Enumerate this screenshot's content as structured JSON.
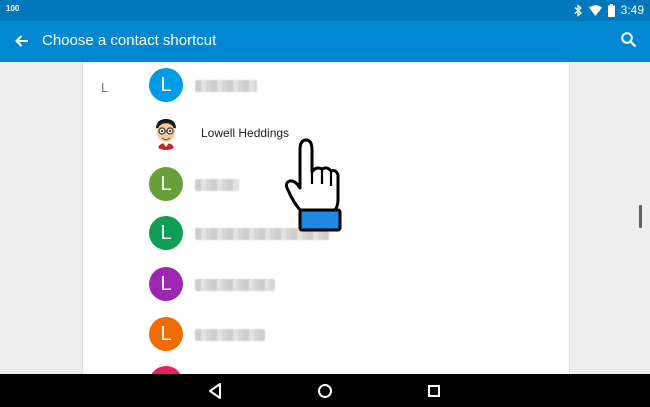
{
  "status_bar": {
    "left_text": "100",
    "time": "3:49",
    "icons": [
      "bluetooth-icon",
      "wifi-icon",
      "battery-icon"
    ]
  },
  "app_bar": {
    "title": "Choose a contact shortcut",
    "icons": [
      "back-arrow-icon",
      "search-icon"
    ]
  },
  "contacts": {
    "section_letter": "L",
    "items": [
      {
        "avatar_letter": "L",
        "avatar_color": "#039be5",
        "name": ""
      },
      {
        "avatar_letter": "",
        "avatar_color": "",
        "name": "Lowell Heddings"
      },
      {
        "avatar_letter": "L",
        "avatar_color": "#689f38",
        "name": ""
      },
      {
        "avatar_letter": "L",
        "avatar_color": "#0f9d58",
        "name": ""
      },
      {
        "avatar_letter": "L",
        "avatar_color": "#9c27b0",
        "name": ""
      },
      {
        "avatar_letter": "L",
        "avatar_color": "#ef6c00",
        "name": ""
      }
    ]
  },
  "nav_bar": {
    "icons": [
      "back-triangle-icon",
      "home-circle-icon",
      "recents-square-icon"
    ]
  },
  "colors": {
    "status_bar": "#0277bd",
    "app_bar": "#0288d1",
    "pointer_cuff": "#1e88e5"
  }
}
